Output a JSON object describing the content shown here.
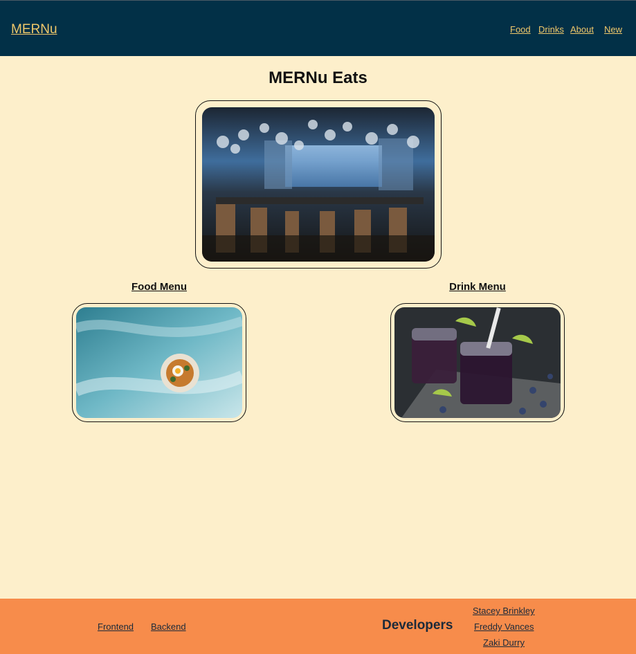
{
  "header": {
    "brand": "MERNu",
    "nav": [
      "Food",
      "Drinks",
      "About",
      "New"
    ]
  },
  "main": {
    "title": "MERNu Eats",
    "hero_image": "restaurant-interior-photo",
    "food_link": "Food Menu",
    "food_image": "plated-food-photo",
    "drink_link": "Drink Menu",
    "drink_image": "blueberry-drinks-photo"
  },
  "footer": {
    "frontend_link": "Frontend",
    "backend_link": "Backend",
    "developers_heading": "Developers",
    "developers": [
      "Stacey Brinkley",
      "Freddy Vances",
      "Zaki Durry"
    ]
  },
  "colors": {
    "header_bg": "#023047",
    "accent_text": "#f0c86a",
    "page_bg": "#fdefcb",
    "footer_bg": "#f78c4b"
  }
}
